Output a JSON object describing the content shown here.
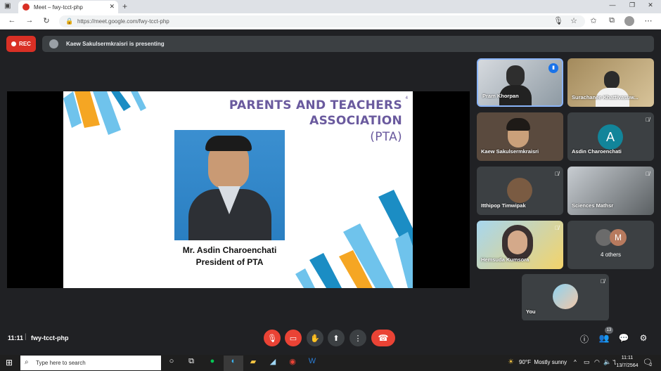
{
  "browser": {
    "tab_title": "Meet – fwy-tcct-php",
    "url": "https://meet.google.com/fwy-tcct-php"
  },
  "meet": {
    "rec_label": "REC",
    "presenting_text": "Kaew Sakulsermkraisri is presenting",
    "meeting_code": "fwy-tcct-php",
    "time": "11:11",
    "participant_count": "13",
    "slide": {
      "title_line1": "PARENTS AND TEACHERS",
      "title_line2": "ASSOCIATION",
      "title_line3": "(PTA)",
      "page_number": "4",
      "caption_name": "Mr. Asdin Charoenchati",
      "caption_role": "President of PTA"
    },
    "tiles": [
      {
        "name": "Pram Khorpan"
      },
      {
        "name": "Surachanee Khattivasuw..."
      },
      {
        "name": "Kaew Sakulsermkraisri"
      },
      {
        "name": "Asdin Charoenchati",
        "avatar": "A"
      },
      {
        "name": "Itthipop Timwipak"
      },
      {
        "name": "Sciences Mathsr"
      },
      {
        "name": "Hemsuda Kumsora"
      },
      {
        "name": "4 others",
        "avatar": "M"
      },
      {
        "name": "You"
      }
    ]
  },
  "taskbar": {
    "search_placeholder": "Type here to search",
    "weather": "90°F  Mostly sunny",
    "clock_time": "11:11",
    "clock_date": "13/7/2564",
    "notif_count": "2"
  },
  "colors": {
    "rec": "#d93025",
    "stage_bg": "#202124",
    "slide_title": "#6a5a9e",
    "avatar_teal": "#12859a"
  }
}
